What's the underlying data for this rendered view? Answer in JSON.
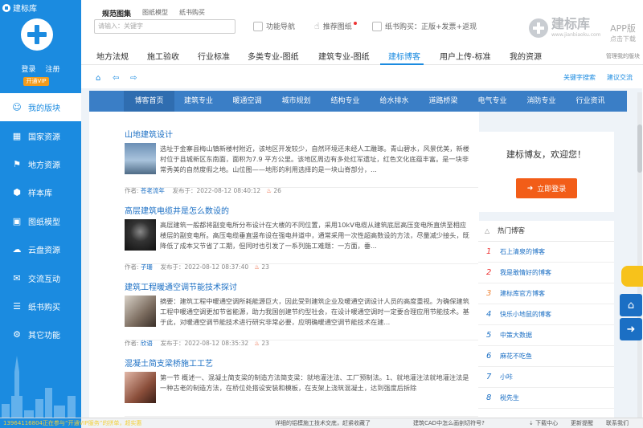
{
  "app": {
    "title": "建标库"
  },
  "sidebar": {
    "login": "登录",
    "register": "注册",
    "vip": "开通VIP",
    "items": [
      {
        "label": "我的版块",
        "icon": "person-icon",
        "glyph": "☺",
        "active": true
      },
      {
        "label": "国家资源",
        "icon": "grid-icon",
        "glyph": "▦",
        "active": false
      },
      {
        "label": "地方资源",
        "icon": "map-icon",
        "glyph": "⚑",
        "active": false
      },
      {
        "label": "样本库",
        "icon": "cube-icon",
        "glyph": "⬢",
        "active": false
      },
      {
        "label": "图纸模型",
        "icon": "layers-icon",
        "glyph": "▣",
        "active": false
      },
      {
        "label": "云盘资源",
        "icon": "cloud-icon",
        "glyph": "☁",
        "active": false
      },
      {
        "label": "交流互动",
        "icon": "chat-icon",
        "glyph": "✉",
        "active": false
      },
      {
        "label": "纸书购买",
        "icon": "book-icon",
        "glyph": "☰",
        "active": false
      },
      {
        "label": "其它功能",
        "icon": "more-icon",
        "glyph": "⚙",
        "active": false
      }
    ]
  },
  "header": {
    "tabs": [
      "规范图集",
      "图纸模型",
      "纸书购买"
    ],
    "search_placeholder": "请输入：关键字",
    "func_nav": "功能导航",
    "recommend": "推荐图纸",
    "paper_book": "纸书购买：正版+发票+返现",
    "brand_name": "建标库",
    "brand_url": "www.jianbiaoku.com",
    "app_label": "APP版",
    "app_sub": "点击下载"
  },
  "nav": {
    "items": [
      "地方法规",
      "施工验收",
      "行业标准",
      "多类专业-图纸",
      "建筑专业-图纸",
      "建标博客",
      "用户上传-标准",
      "我的资源"
    ],
    "manage": "管理我的版块"
  },
  "toolbar": {
    "keyword_search": "关键字搜索",
    "feedback": "建议交流"
  },
  "blognav": [
    "博客首页",
    "建筑专业",
    "暖通空调",
    "城市规划",
    "结构专业",
    "给水排水",
    "道路桥梁",
    "电气专业",
    "消防专业",
    "行业资讯"
  ],
  "posts": [
    {
      "title": "山地建筑设计",
      "excerpt": "选址于金寨县梅山镇新楼村附近，该地区开发较少，自然环境还未经人工雕琢。青山碧水，风景优美，新楼村位于县城新区东南面，面积为7.9 平方公里。该地区周边有多处红军遗址，红色文化底蕴丰富。是一块非常秀美的自然度假之地。山位图——地形的利用选择的是一块山脊部分，...",
      "author_prefix": "作者:",
      "author": "苍老流年",
      "date": "发布于：2022-08-12 08:40:12",
      "hits": "26"
    },
    {
      "title": "高层建筑电缆井是怎么数设的",
      "excerpt": "高层建筑一般都将副变电所分布设计在大楼的不同位置，采用10kV电缆从建筑底层高压变电所直供至相应楼层的副变电所。高压电缆垂直竖布设在强电井道中，通常采用一次性超高数设的方法，尽量减少接头，既降低了成本又节省了工期，但同时也引发了一系列施工难题：一方面，垂...",
      "author_prefix": "作者:",
      "author": "子珊",
      "date": "发布于：2022-08-12 08:37:40",
      "hits": "23"
    },
    {
      "title": "建筑工程暖通空调节能技术探讨",
      "excerpt": "摘要：建筑工程中暖通空调所耗能源巨大，因此受到建筑企业及暖通空调设计人员的高度重视。为确保建筑工程中暖通空调更加节省能源，助力我国创建节约型社会，在设计暖通空调时一定要合理应用节能技术。基于此，对暖通空调节能技术进行研究非常必要，应明确暖通空调节能技术在建...",
      "author_prefix": "作者:",
      "author": "欣语",
      "date": "发布于：2022-08-12 08:35:32",
      "hits": "23"
    },
    {
      "title": "混凝土简支梁桥施工工艺",
      "excerpt": "第一节 概述一、混凝土简支梁的制造方法简支梁：就地灌注法、工厂预制法。1、就地灌注法就地灌注法是一种古老的制造方法，在桥位处搭设安装和模板，在支架上浇筑混凝土，达到强度后拆除",
      "author_prefix": "",
      "author": "",
      "date": "",
      "hits": ""
    }
  ],
  "welcome": {
    "text": "建标博友，欢迎您！",
    "login_btn": "立即登录"
  },
  "hot": {
    "title": "热门博客",
    "items": [
      {
        "n": "1",
        "label": "石上清泉的博客"
      },
      {
        "n": "2",
        "label": "我是敢情好的博客"
      },
      {
        "n": "3",
        "label": "建标库官方博客"
      },
      {
        "n": "4",
        "label": "快乐小地鼠的博客"
      },
      {
        "n": "5",
        "label": "中策大数据"
      },
      {
        "n": "6",
        "label": "麻花不吃鱼"
      },
      {
        "n": "7",
        "label": "小咔"
      },
      {
        "n": "8",
        "label": "税先生"
      }
    ]
  },
  "status": {
    "marquee": "13964116804正在参与“开通VIP服务”的拼单，超实惠",
    "news1": "详细的铝模施工技术交底，赶紧收藏了",
    "news2": "建筑CAD中怎么画剖切符号?",
    "download": "下载中心",
    "update": "更新提醒",
    "contact": "联系我们"
  }
}
